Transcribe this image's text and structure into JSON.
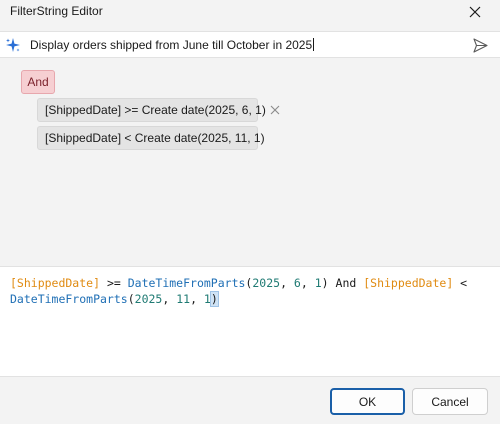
{
  "window": {
    "title": "FilterString Editor"
  },
  "prompt": {
    "text": "Display orders shipped from June till October in 2025"
  },
  "builder": {
    "group_operator": "And",
    "conditions": [
      {
        "label": "[ShippedDate] >= Create date(2025, 6, 1)"
      },
      {
        "label": "[ShippedDate] < Create date(2025, 11, 1)"
      }
    ]
  },
  "editor": {
    "tokens": [
      "[ShippedDate]",
      " >= ",
      "DateTimeFromParts",
      "(",
      "2025",
      ", ",
      "6",
      ", ",
      "1",
      ") ",
      "And",
      " ",
      "[ShippedDate]",
      " <",
      "\n",
      "DateTimeFromParts",
      "(",
      "2025",
      ", ",
      "11",
      ", ",
      "1",
      ")"
    ]
  },
  "footer": {
    "ok_label": "OK",
    "cancel_label": "Cancel"
  },
  "colors": {
    "field": "#e08b12",
    "function": "#1f6fb5",
    "number": "#1f7a73",
    "group_bg": "#f6cfd2",
    "ok_border": "#1a5fa8"
  },
  "icons": {
    "ai": "sparkle-icon",
    "send": "send-icon",
    "close": "close-icon",
    "remove": "remove-condition-icon"
  }
}
